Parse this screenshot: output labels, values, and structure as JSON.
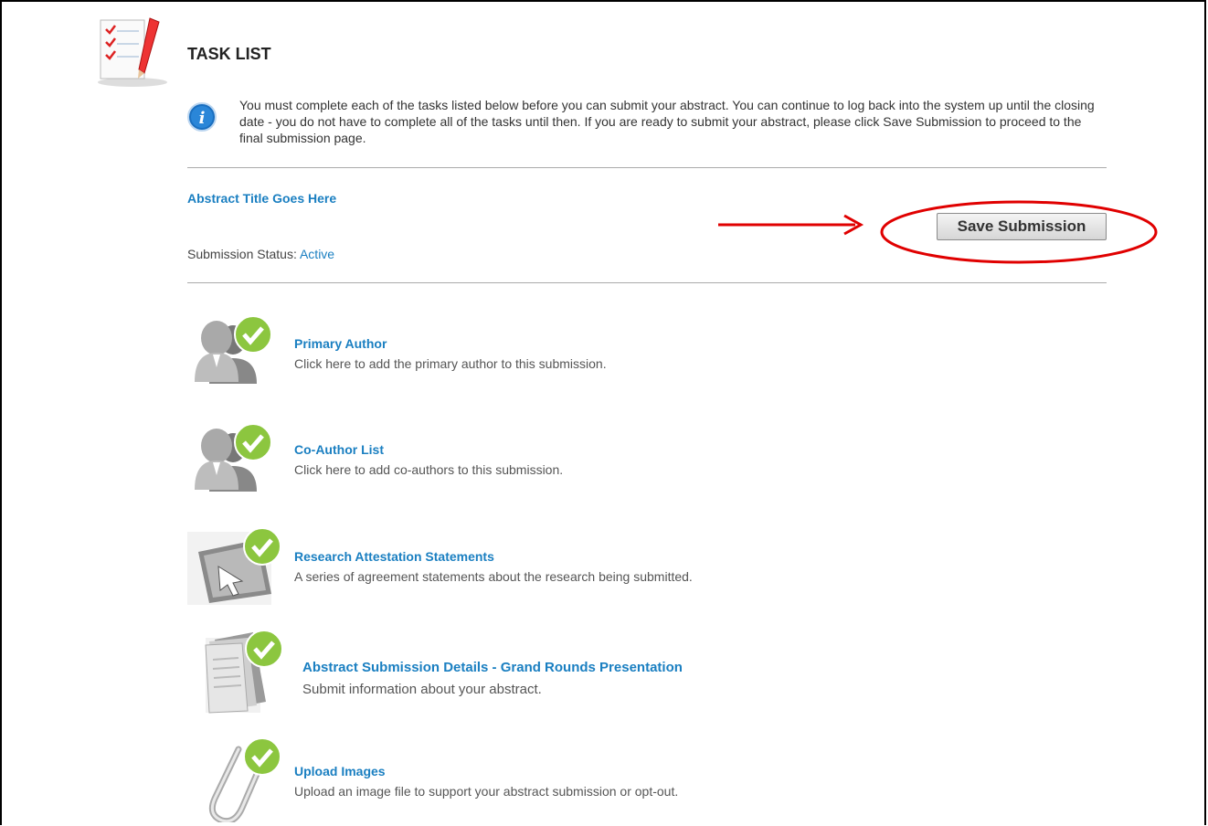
{
  "header": {
    "title": "TASK LIST",
    "info_text": "You must complete each of the tasks listed below before you can submit your abstract. You can continue to log back into the system up until the closing date - you do not have to complete all of the tasks until then. If you are ready to submit your abstract, please click Save Submission to proceed to the final submission page."
  },
  "submission": {
    "abstract_title": "Abstract Title Goes Here",
    "status_label": "Submission Status:",
    "status_value": "Active",
    "save_label": "Save Submission"
  },
  "tasks": [
    {
      "name": "Primary Author",
      "description": "Click here to add the primary author to this submission.",
      "icon": "primary-author-icon",
      "complete": true
    },
    {
      "name": "Co-Author List",
      "description": "Click here to add co-authors to this submission.",
      "icon": "co-author-icon",
      "complete": true
    },
    {
      "name": "Research Attestation Statements",
      "description": "A series of agreement statements about the research being submitted.",
      "icon": "attestation-icon",
      "complete": true
    },
    {
      "name": "Abstract Submission Details - Grand Rounds Presentation",
      "description": "Submit information about your abstract.",
      "icon": "documents-icon",
      "complete": true
    },
    {
      "name": "Upload Images",
      "description": "Upload an image file to support your abstract submission or opt-out.",
      "icon": "paperclip-icon",
      "complete": true
    }
  ],
  "colors": {
    "link": "#1a7fc1",
    "annotation": "#e00000",
    "check": "#7ec130"
  }
}
